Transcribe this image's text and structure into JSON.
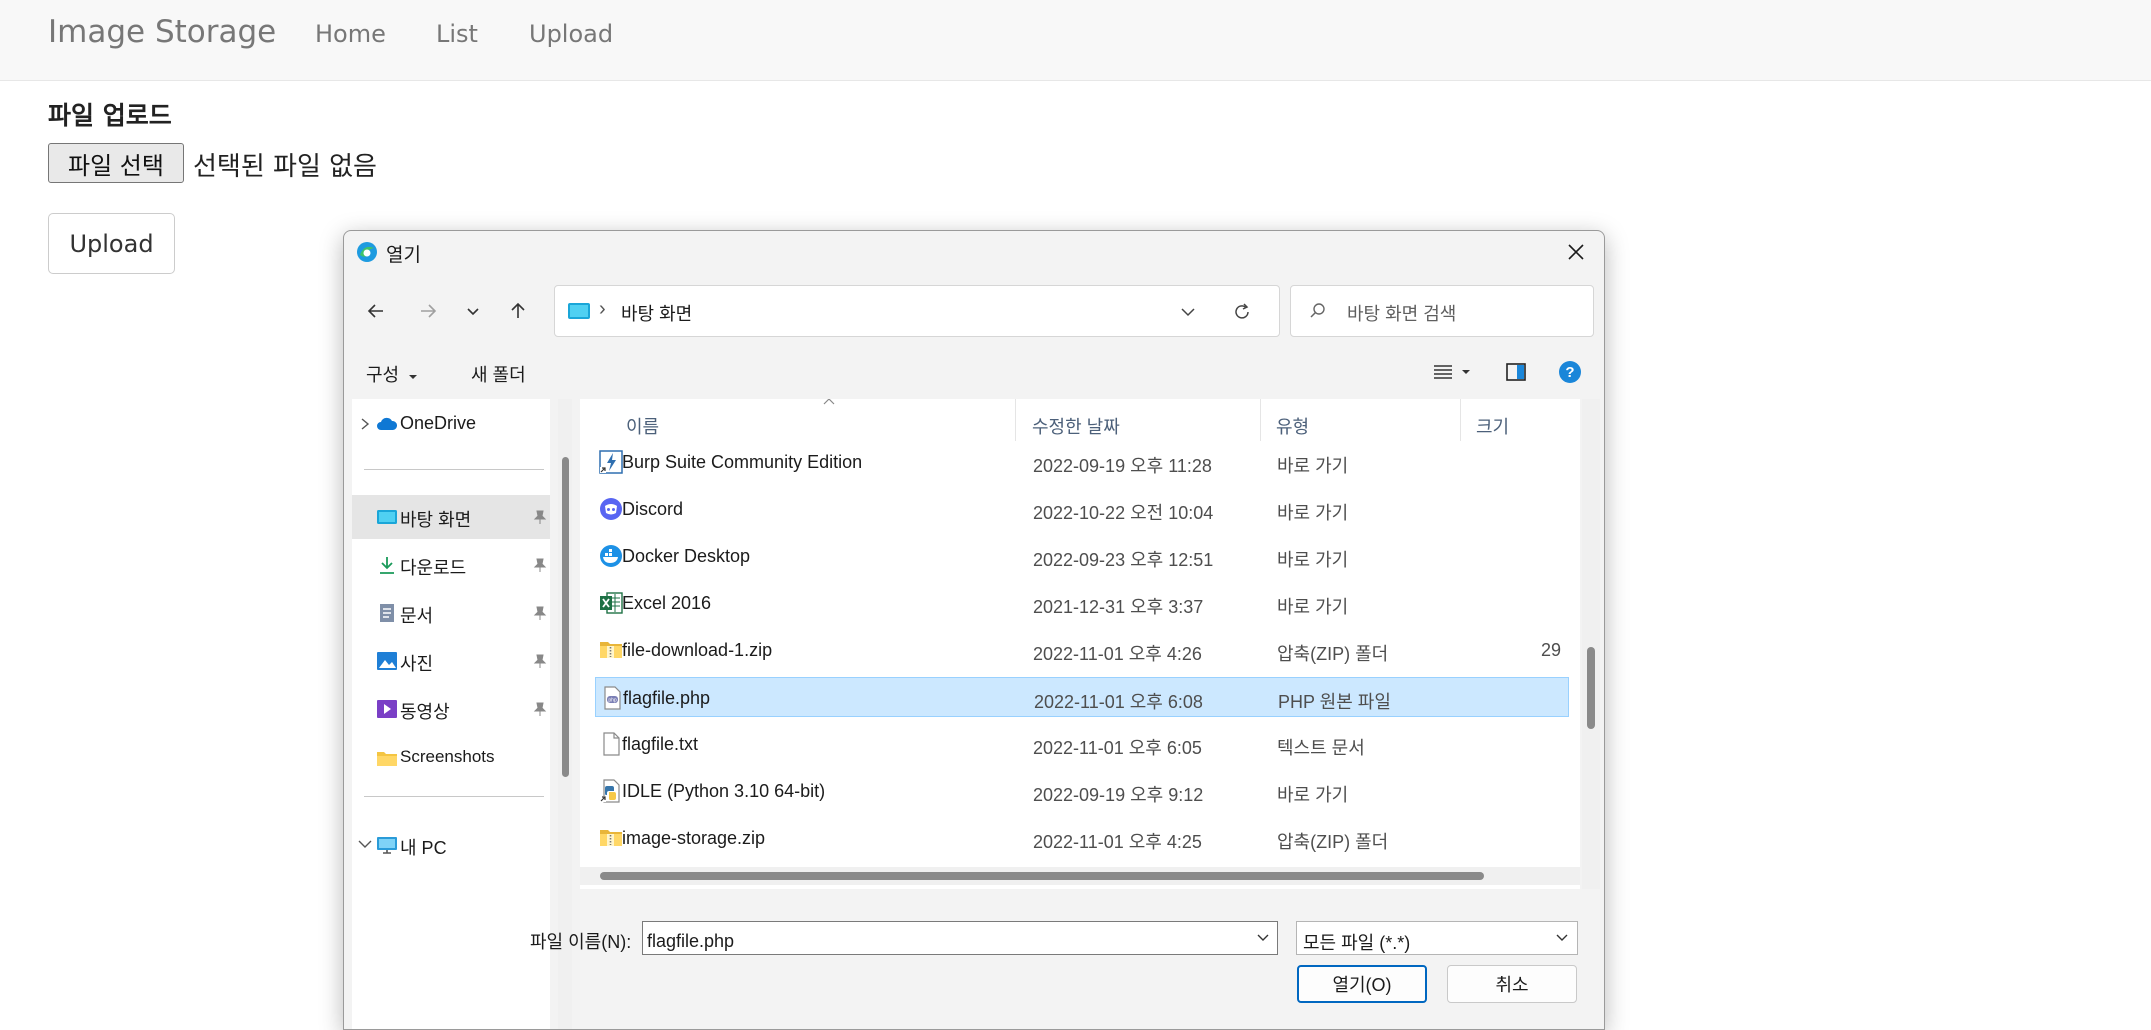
{
  "site": {
    "brand": "Image Storage",
    "nav": [
      "Home",
      "List",
      "Upload"
    ]
  },
  "upload_form": {
    "heading": "파일 업로드",
    "choose_file_label": "파일 선택",
    "no_file_text": "선택된 파일 없음",
    "upload_button": "Upload"
  },
  "dialog": {
    "title": "열기",
    "address": {
      "location": "바탕 화면",
      "separator": "›"
    },
    "search_placeholder": "바탕 화면 검색",
    "command_bar": {
      "organize": "구성",
      "new_folder": "새 폴더"
    },
    "nav_pane": [
      {
        "label": "OneDrive",
        "icon": "cloud-icon",
        "pinned": false
      },
      {
        "label": "바탕 화면",
        "icon": "desktop-icon",
        "pinned": true,
        "selected": true
      },
      {
        "label": "다운로드",
        "icon": "download-icon",
        "pinned": true
      },
      {
        "label": "문서",
        "icon": "document-icon",
        "pinned": true
      },
      {
        "label": "사진",
        "icon": "picture-icon",
        "pinned": true
      },
      {
        "label": "동영상",
        "icon": "video-icon",
        "pinned": true
      },
      {
        "label": "Screenshots",
        "icon": "folder-icon",
        "pinned": false
      },
      {
        "label": "내 PC",
        "icon": "pc-icon",
        "pinned": false
      }
    ],
    "columns": {
      "name": "이름",
      "modified": "수정한 날짜",
      "type": "유형",
      "size": "크기"
    },
    "files": [
      {
        "name": "Burp Suite Community Edition",
        "modified": "2022-09-19 오후 11:28",
        "type": "바로 가기",
        "size": "",
        "icon": "burp-suite-icon"
      },
      {
        "name": "Discord",
        "modified": "2022-10-22 오전 10:04",
        "type": "바로 가기",
        "size": "",
        "icon": "discord-icon"
      },
      {
        "name": "Docker Desktop",
        "modified": "2022-09-23 오후 12:51",
        "type": "바로 가기",
        "size": "",
        "icon": "docker-icon"
      },
      {
        "name": "Excel 2016",
        "modified": "2021-12-31 오후 3:37",
        "type": "바로 가기",
        "size": "",
        "icon": "excel-icon"
      },
      {
        "name": "file-download-1.zip",
        "modified": "2022-11-01 오후 4:26",
        "type": "압축(ZIP) 폴더",
        "size": "29",
        "icon": "zip-folder-icon"
      },
      {
        "name": "flagfile.php",
        "modified": "2022-11-01 오후 6:08",
        "type": "PHP 원본 파일",
        "size": "",
        "icon": "php-file-icon",
        "selected": true
      },
      {
        "name": "flagfile.txt",
        "modified": "2022-11-01 오후 6:05",
        "type": "텍스트 문서",
        "size": "",
        "icon": "text-file-icon"
      },
      {
        "name": "IDLE (Python 3.10 64-bit)",
        "modified": "2022-09-19 오후 9:12",
        "type": "바로 가기",
        "size": "",
        "icon": "python-idle-icon"
      },
      {
        "name": "image-storage.zip",
        "modified": "2022-11-01 오후 4:25",
        "type": "압축(ZIP) 폴더",
        "size": "",
        "icon": "zip-folder-icon"
      }
    ],
    "filename_label": "파일 이름(N):",
    "filename_value": "flagfile.php",
    "filetype_value": "모든 파일 (*.*)",
    "open_button": "열기(O)",
    "cancel_button": "취소"
  },
  "colors": {
    "selection": "#cce8ff",
    "selection_border": "#99d1ff",
    "primary_border": "#0067c0",
    "help": "#1a86d9"
  }
}
